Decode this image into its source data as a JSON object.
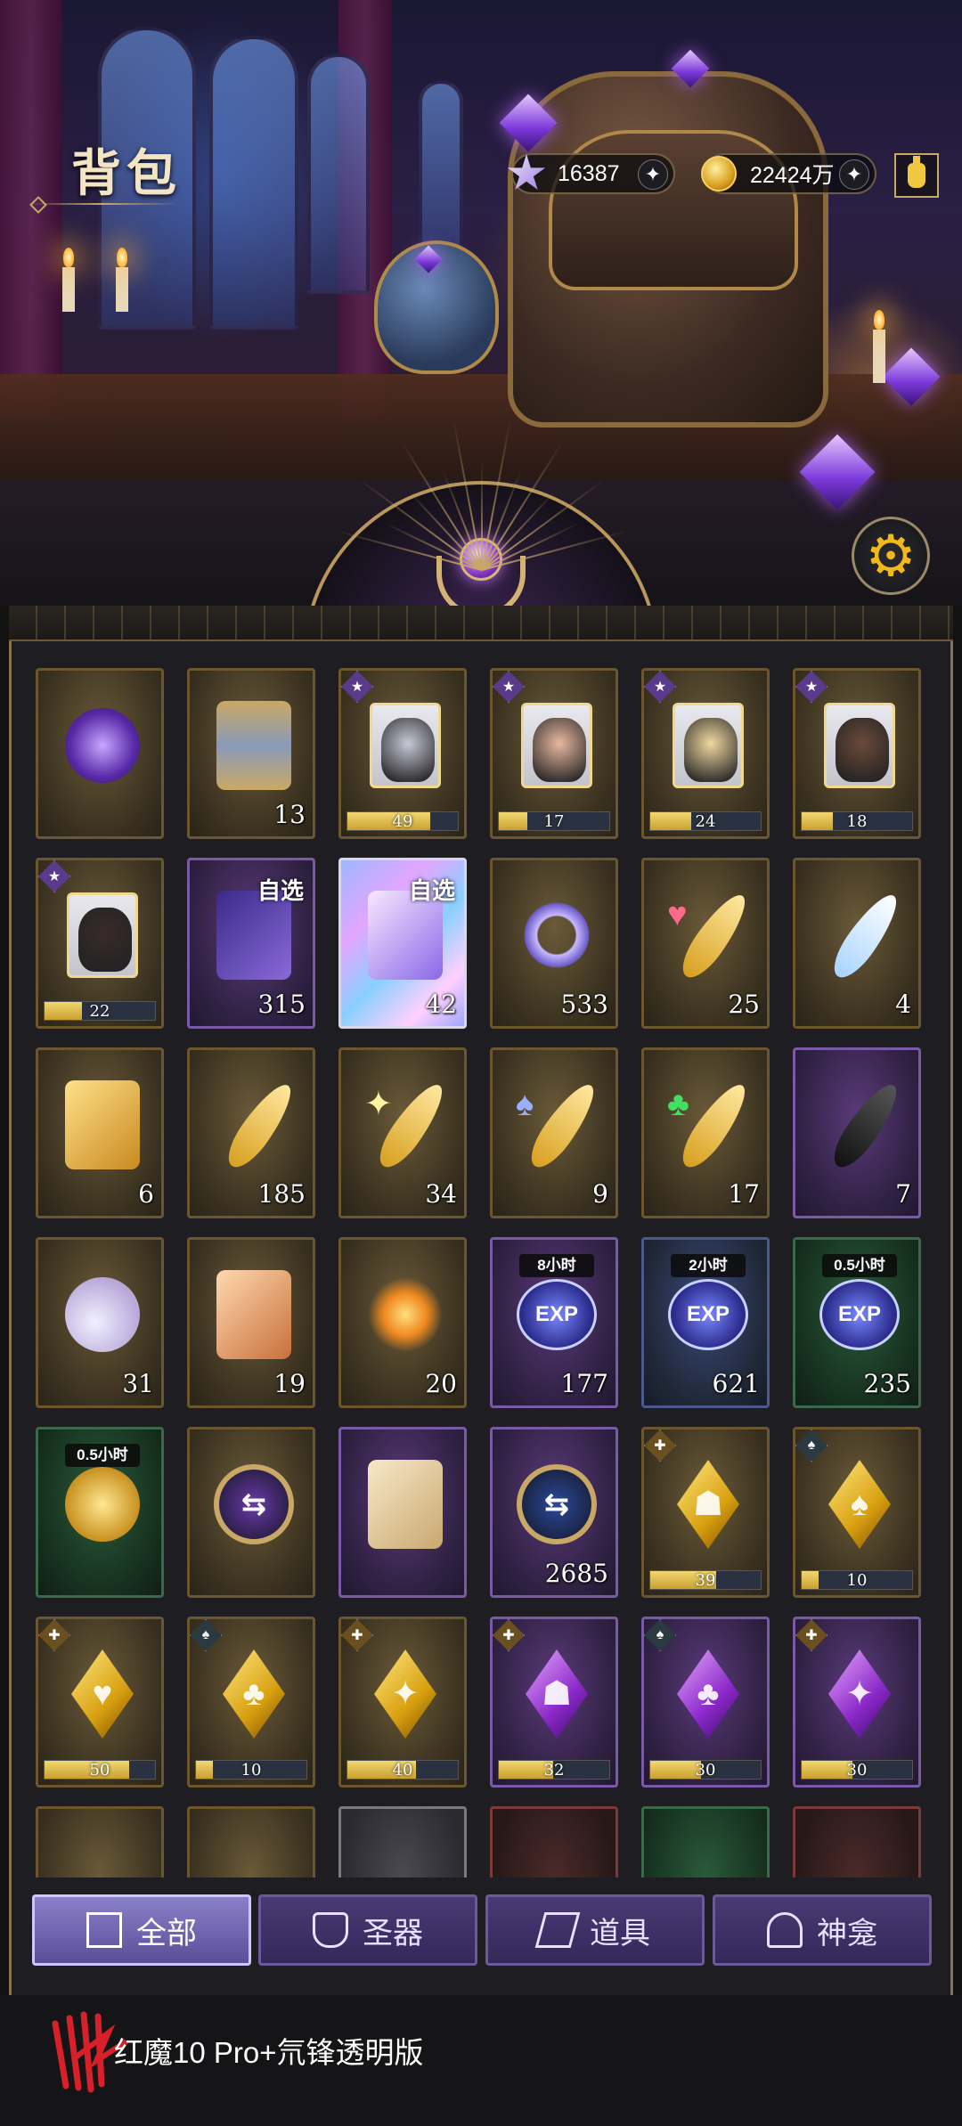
{
  "header": {
    "title": "背包",
    "currency": [
      {
        "icon": "star-gem-icon",
        "value": "16387"
      },
      {
        "icon": "gold-coin-icon",
        "value": "22424万"
      }
    ]
  },
  "tabs": [
    {
      "label": "全部",
      "icon": "all-icon",
      "active": true
    },
    {
      "label": "圣器",
      "icon": "chalice-icon",
      "active": false
    },
    {
      "label": "道具",
      "icon": "items-icon",
      "active": false
    },
    {
      "label": "神龛",
      "icon": "shrine-icon",
      "active": false
    }
  ],
  "items": [
    [
      {
        "name": "orb-pendant",
        "frame": "gold",
        "count": ""
      },
      {
        "name": "hourglass",
        "frame": "gold",
        "count": "13"
      },
      {
        "name": "puzzle-piece-silver-hair",
        "frame": "gold",
        "badge": "star",
        "progress": 49,
        "progress_fill": 0.75
      },
      {
        "name": "puzzle-piece-lady",
        "frame": "gold",
        "badge": "star",
        "progress": 17,
        "progress_fill": 0.26
      },
      {
        "name": "puzzle-piece-blonde",
        "frame": "gold",
        "badge": "star",
        "progress": 24,
        "progress_fill": 0.37
      },
      {
        "name": "puzzle-piece-dark-hair",
        "frame": "gold",
        "badge": "star",
        "progress": 18,
        "progress_fill": 0.28
      }
    ],
    [
      {
        "name": "puzzle-piece-dark-figure",
        "frame": "gold",
        "badge": "star",
        "progress": 22,
        "progress_fill": 0.34
      },
      {
        "name": "selectable-card-box",
        "frame": "purple",
        "tag": "自选",
        "count": "315"
      },
      {
        "name": "selectable-prism",
        "frame": "holo",
        "tag": "自选",
        "count": "42"
      },
      {
        "name": "crystal-ring",
        "frame": "gold",
        "count": "533"
      },
      {
        "name": "heart-feather",
        "frame": "gold",
        "count": "25"
      },
      {
        "name": "white-feather",
        "frame": "gold",
        "count": "4"
      }
    ],
    [
      {
        "name": "jeweled-key",
        "frame": "gold",
        "count": "6"
      },
      {
        "name": "gold-feather",
        "frame": "gold",
        "count": "185"
      },
      {
        "name": "diamond-feather",
        "frame": "gold",
        "count": "34"
      },
      {
        "name": "spade-feather",
        "frame": "gold",
        "count": "9"
      },
      {
        "name": "club-feather",
        "frame": "gold",
        "count": "17"
      },
      {
        "name": "black-feather",
        "frame": "purple",
        "count": "7"
      }
    ],
    [
      {
        "name": "perfume-bottle",
        "frame": "gold",
        "count": "31"
      },
      {
        "name": "conch-shell",
        "frame": "gold",
        "count": "19"
      },
      {
        "name": "fireworks",
        "frame": "gold",
        "count": "20"
      },
      {
        "name": "exp-chest",
        "frame": "purple",
        "timer": "8小时",
        "count": "177"
      },
      {
        "name": "exp-bag",
        "frame": "blue",
        "timer": "2小时",
        "count": "621"
      },
      {
        "name": "exp-orbs",
        "frame": "green",
        "timer": "0.5小时",
        "count": "235"
      }
    ],
    [
      {
        "name": "gold-coins",
        "frame": "green",
        "timer": "0.5小时",
        "count": ""
      },
      {
        "name": "purple-token",
        "frame": "gold",
        "count": ""
      },
      {
        "name": "scroll-ticket",
        "frame": "purple",
        "count": ""
      },
      {
        "name": "blue-token",
        "frame": "purple",
        "count": "2685"
      },
      {
        "name": "gold-shard-figure",
        "frame": "gold",
        "badge": "gold",
        "progress": 39,
        "progress_fill": 0.6
      },
      {
        "name": "gold-shard-spade",
        "frame": "gold",
        "badge": "teal",
        "progress": 10,
        "progress_fill": 0.15
      }
    ],
    [
      {
        "name": "gold-shard-heart",
        "frame": "gold",
        "badge": "gold",
        "progress": 50,
        "progress_fill": 0.77
      },
      {
        "name": "gold-shard-club",
        "frame": "gold",
        "badge": "teal",
        "progress": 10,
        "progress_fill": 0.15
      },
      {
        "name": "gold-shard-diamond",
        "frame": "gold",
        "badge": "gold",
        "progress": 40,
        "progress_fill": 0.62
      },
      {
        "name": "purple-shard-figure",
        "frame": "purple",
        "badge": "gold",
        "progress": 32,
        "progress_fill": 0.49
      },
      {
        "name": "purple-shard-club",
        "frame": "purple",
        "badge": "teal",
        "progress": 30,
        "progress_fill": 0.46
      },
      {
        "name": "purple-shard-diamond",
        "frame": "purple",
        "badge": "gold",
        "progress": 30,
        "progress_fill": 0.46
      }
    ]
  ],
  "partial_row_frames": [
    "gold",
    "gold",
    "gray",
    "red",
    "green",
    "red"
  ],
  "watermark": "红魔10 Pro+氘锋透明版"
}
